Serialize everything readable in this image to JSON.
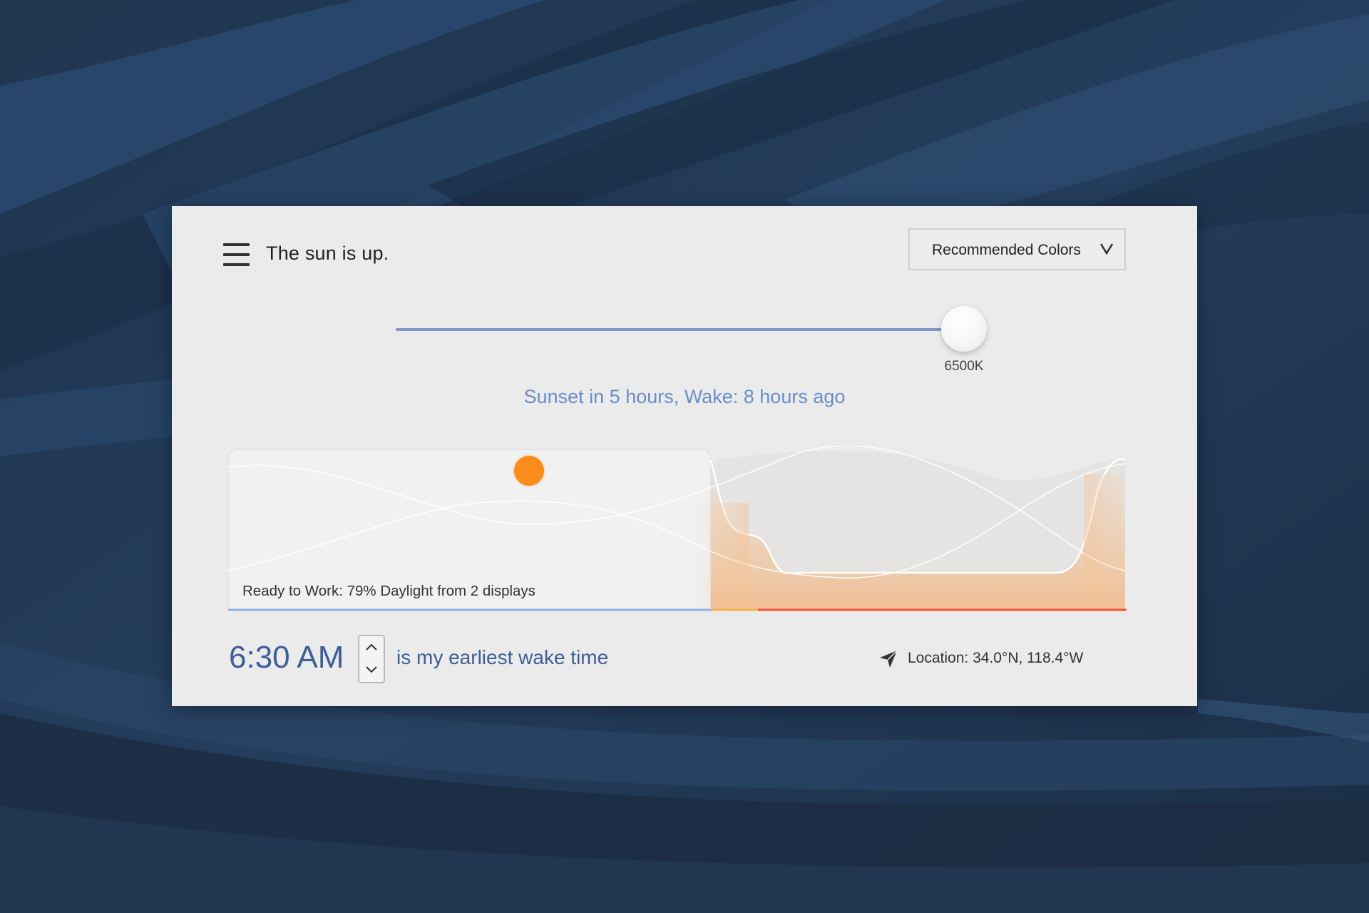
{
  "app": {
    "status_title": "The sun is up.",
    "color_mode": {
      "selected": "Recommended Colors"
    }
  },
  "temperature_slider": {
    "value_label": "6500K",
    "value_kelvin": 6500,
    "fill_fraction": 1.0
  },
  "sunset_info": "Sunset in 5 hours, Wake: 8 hours ago",
  "day_graph": {
    "status_text": "Ready to Work: 79% Daylight from 2 displays",
    "sun_position_fraction": 0.335,
    "colors": {
      "sun": "#fb8c1c",
      "day_line": "#8fb0e6",
      "transition_line": "#f7b24a",
      "night_line": "#f2553b",
      "night_glow": "#f4c08c"
    }
  },
  "wake": {
    "time": "6:30 AM",
    "label": "is my earliest wake time"
  },
  "location": {
    "text": "Location: 34.0°N, 118.4°W",
    "icon": "location-arrow-icon"
  },
  "icons": {
    "menu": "hamburger-menu-icon",
    "dropdown": "chevron-down-icon",
    "stepper_up": "chevron-up-icon",
    "stepper_down": "chevron-down-icon"
  },
  "theme": {
    "accent": "#6a8dc8",
    "wake_text": "#3e5e96",
    "panel_bg": "#ebebeb"
  }
}
